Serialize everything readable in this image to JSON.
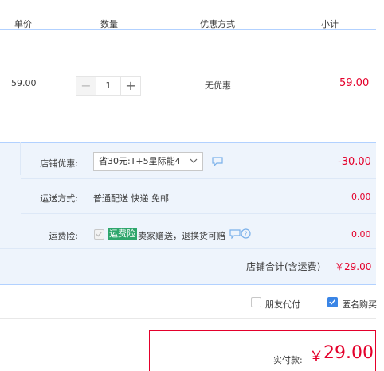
{
  "header": {
    "col_unit_price": "单价",
    "col_quantity": "数量",
    "col_discount": "优惠方式",
    "col_subtotal": "小计"
  },
  "item": {
    "unit_price": "59.00",
    "quantity": "1",
    "discount": "无优惠",
    "subtotal": "59.00",
    "minus_label": "−",
    "plus_label": "+"
  },
  "shop": {
    "discount_label": "店铺优惠:",
    "discount_selected": "省30元:T+5星际能4",
    "discount_amount": "-30.00",
    "shipping_label": "运送方式:",
    "shipping_value": "普通配送 快递 免邮",
    "shipping_amount": "0.00",
    "insurance_label": "运费险:",
    "insurance_badge": "运费险",
    "insurance_text": "卖家赠送，退换货可赔",
    "insurance_amount": "0.00",
    "total_label": "店铺合计(含运费)",
    "total_value": "￥29.00"
  },
  "options": {
    "friend_pay": "朋友代付",
    "anonymous": "匿名购买"
  },
  "payment": {
    "label": "实付款:",
    "currency": "￥",
    "amount": "29.00"
  },
  "colors": {
    "accent_red": "#e4002b",
    "accent_blue": "#3a85e6",
    "badge_green": "#2ea66c"
  }
}
